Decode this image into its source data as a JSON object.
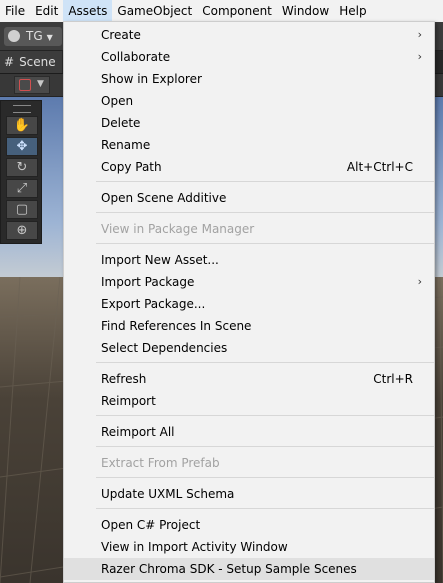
{
  "menubar": {
    "items": [
      "File",
      "Edit",
      "Assets",
      "GameObject",
      "Component",
      "Window",
      "Help"
    ]
  },
  "toolbar": {
    "account_label": "TG"
  },
  "scene_tab": {
    "label": "Scene",
    "icon": "hash-icon"
  },
  "tools": [
    "hand-icon",
    "move-icon",
    "rotate-icon",
    "scale-icon",
    "rect-icon",
    "transform-icon"
  ],
  "menu": {
    "items": {
      "create": "Create",
      "collaborate": "Collaborate",
      "show_in_explorer": "Show in Explorer",
      "open": "Open",
      "delete": "Delete",
      "rename": "Rename",
      "copy_path": "Copy Path",
      "copy_path_shortcut": "Alt+Ctrl+C",
      "open_scene_additive": "Open Scene Additive",
      "view_in_package_manager": "View in Package Manager",
      "import_new_asset": "Import New Asset...",
      "import_package": "Import Package",
      "export_package": "Export Package...",
      "find_references": "Find References In Scene",
      "select_dependencies": "Select Dependencies",
      "refresh": "Refresh",
      "refresh_shortcut": "Ctrl+R",
      "reimport": "Reimport",
      "reimport_all": "Reimport All",
      "extract_from_prefab": "Extract From Prefab",
      "update_uxml_schema": "Update UXML Schema",
      "open_csharp_project": "Open C# Project",
      "view_import_activity": "View in Import Activity Window",
      "razer_chroma": "Razer Chroma SDK - Setup Sample Scenes"
    },
    "submenu_arrow": "›"
  }
}
